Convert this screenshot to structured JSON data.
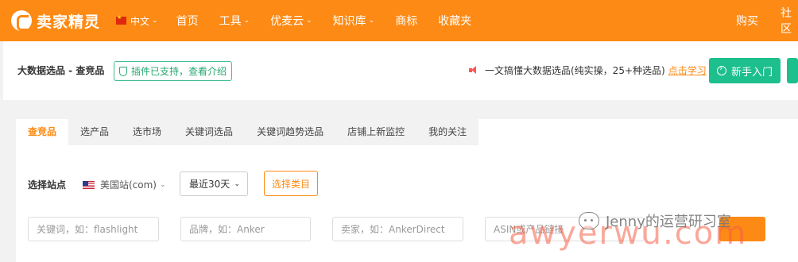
{
  "header": {
    "logo_text": "卖家精灵",
    "language": "中文",
    "nav": [
      "首页",
      "工具",
      "优麦云",
      "知识库",
      "商标",
      "收藏夹"
    ],
    "right_links": [
      "购买",
      "社区"
    ]
  },
  "subheader": {
    "title": "大数据选品 - 查竞品",
    "plugin_badge": "插件已支持，查看介绍",
    "promo_text": "一文搞懂大数据选品(纯实操，25+种选品)",
    "promo_link": "点击学习",
    "beginner_button": "新手入门"
  },
  "tabs": {
    "items": [
      "查竞品",
      "选产品",
      "选市场",
      "关键词选品",
      "关键词趋势选品",
      "店铺上新监控",
      "我的关注"
    ],
    "active": "查竞品"
  },
  "filters": {
    "site_label": "选择站点",
    "site_value": "美国站(com)",
    "range_value": "最近30天",
    "category_button": "选择类目",
    "keyword_placeholder": "关键词，如：flashlight",
    "brand_placeholder": "品牌，如：Anker",
    "seller_placeholder": "卖家，如：AnkerDirect",
    "asin_placeholder": "ASIN或产品链接"
  },
  "watermark": {
    "account": "Jenny的运营研习室",
    "site": "awyerwu.com"
  },
  "colors": {
    "brand_orange": "#fd8a14",
    "green": "#1dbf8c"
  }
}
